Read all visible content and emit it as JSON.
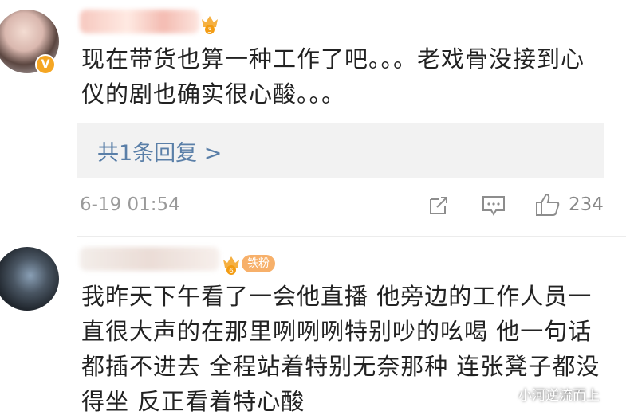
{
  "comments": [
    {
      "text": "现在带货也算一种工作了吧。。。老戏骨没接到心仪的剧也确实很心酸。。。",
      "badge_icon": "crown-icon",
      "verified_badge": "V",
      "reply_link": "共1条回复 >",
      "timestamp": "6-19 01:54",
      "likes": "234"
    },
    {
      "text": "我昨天下午看了一会他直播 他旁边的工作人员一直很大声的在那里咧咧咧特别吵的吆喝 他一句话都插不进去 全程站着特别无奈那种 连张凳子都没得坐 反正看着特心酸",
      "badge_icon": "crown-icon",
      "fan_badge": "铁粉"
    }
  ],
  "watermark": "小河逆流而上",
  "colors": {
    "link": "#5a7fa8",
    "fan_badge": "#f7b06a",
    "verified": "#f5a623"
  }
}
